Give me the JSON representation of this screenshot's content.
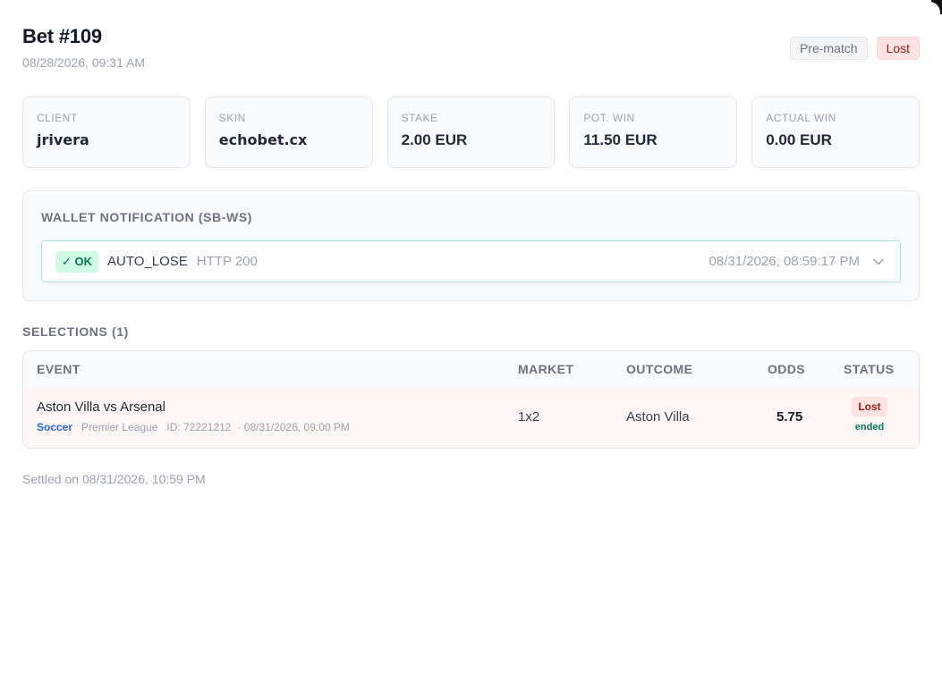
{
  "bet": {
    "title": "Bet #109",
    "placed_at": "08/28/2026, 09:31 AM",
    "badges": {
      "mode": "Pre-match",
      "result": "Lost"
    }
  },
  "summary": [
    {
      "label": "CLIENT",
      "value": "jrivera"
    },
    {
      "label": "SKIN",
      "value": "echobet.cx"
    },
    {
      "label": "STAKE",
      "value": "2.00 EUR"
    },
    {
      "label": "POT. WIN",
      "value": "11.50 EUR"
    },
    {
      "label": "ACTUAL WIN",
      "value": "0.00 EUR"
    }
  ],
  "wallet": {
    "heading": "WALLET NOTIFICATION (SB-WS)",
    "notification": {
      "status": "✓ OK",
      "type": "AUTO_LOSE",
      "http": "HTTP 200",
      "timestamp": "08/31/2026, 08:59:17 PM",
      "expand_icon": "chevron-down-icon"
    }
  },
  "selections": {
    "heading": "SELECTIONS (1)",
    "columns": {
      "event": "EVENT",
      "market": "MARKET",
      "outcome": "OUTCOME",
      "odds": "ODDS",
      "status": "STATUS"
    },
    "rows": [
      {
        "event": "Aston Villa vs Arsenal",
        "sport": "Soccer",
        "league": "Premier League",
        "event_id": "ID: 72221212",
        "start": "· 08/31/2026, 09:00 PM",
        "market": "1x2",
        "outcome": "Aston Villa",
        "odds": "5.75",
        "status": "Lost",
        "event_state": "ended"
      }
    ]
  },
  "settled": "Settled on 08/31/2026, 10:59 PM",
  "colors": {
    "lost": "#9b1c1c",
    "ok": "#047857",
    "sport_link": "#2563eb"
  }
}
